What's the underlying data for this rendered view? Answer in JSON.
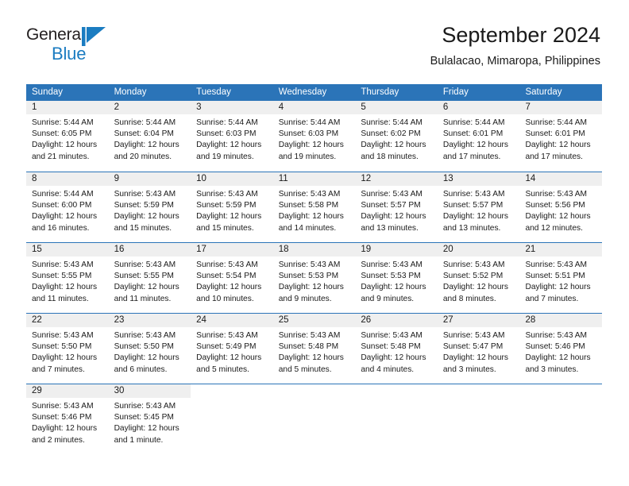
{
  "brand": {
    "name_part1": "General",
    "name_part2": "Blue",
    "mark": "triangle-logo-icon",
    "color_primary": "#1b7cc1",
    "color_text": "#231f20"
  },
  "header": {
    "title": "September 2024",
    "subtitle": "Bulalacao, Mimaropa, Philippines"
  },
  "theme": {
    "header_bar": "#2b74b8",
    "day_band": "#efefef",
    "row_divider": "#2b74b8",
    "text": "#1a1a1a"
  },
  "weekdays": [
    "Sunday",
    "Monday",
    "Tuesday",
    "Wednesday",
    "Thursday",
    "Friday",
    "Saturday"
  ],
  "weeks": [
    [
      {
        "day": "1",
        "sunrise": "Sunrise: 5:44 AM",
        "sunset": "Sunset: 6:05 PM",
        "daylight1": "Daylight: 12 hours",
        "daylight2": "and 21 minutes."
      },
      {
        "day": "2",
        "sunrise": "Sunrise: 5:44 AM",
        "sunset": "Sunset: 6:04 PM",
        "daylight1": "Daylight: 12 hours",
        "daylight2": "and 20 minutes."
      },
      {
        "day": "3",
        "sunrise": "Sunrise: 5:44 AM",
        "sunset": "Sunset: 6:03 PM",
        "daylight1": "Daylight: 12 hours",
        "daylight2": "and 19 minutes."
      },
      {
        "day": "4",
        "sunrise": "Sunrise: 5:44 AM",
        "sunset": "Sunset: 6:03 PM",
        "daylight1": "Daylight: 12 hours",
        "daylight2": "and 19 minutes."
      },
      {
        "day": "5",
        "sunrise": "Sunrise: 5:44 AM",
        "sunset": "Sunset: 6:02 PM",
        "daylight1": "Daylight: 12 hours",
        "daylight2": "and 18 minutes."
      },
      {
        "day": "6",
        "sunrise": "Sunrise: 5:44 AM",
        "sunset": "Sunset: 6:01 PM",
        "daylight1": "Daylight: 12 hours",
        "daylight2": "and 17 minutes."
      },
      {
        "day": "7",
        "sunrise": "Sunrise: 5:44 AM",
        "sunset": "Sunset: 6:01 PM",
        "daylight1": "Daylight: 12 hours",
        "daylight2": "and 17 minutes."
      }
    ],
    [
      {
        "day": "8",
        "sunrise": "Sunrise: 5:44 AM",
        "sunset": "Sunset: 6:00 PM",
        "daylight1": "Daylight: 12 hours",
        "daylight2": "and 16 minutes."
      },
      {
        "day": "9",
        "sunrise": "Sunrise: 5:43 AM",
        "sunset": "Sunset: 5:59 PM",
        "daylight1": "Daylight: 12 hours",
        "daylight2": "and 15 minutes."
      },
      {
        "day": "10",
        "sunrise": "Sunrise: 5:43 AM",
        "sunset": "Sunset: 5:59 PM",
        "daylight1": "Daylight: 12 hours",
        "daylight2": "and 15 minutes."
      },
      {
        "day": "11",
        "sunrise": "Sunrise: 5:43 AM",
        "sunset": "Sunset: 5:58 PM",
        "daylight1": "Daylight: 12 hours",
        "daylight2": "and 14 minutes."
      },
      {
        "day": "12",
        "sunrise": "Sunrise: 5:43 AM",
        "sunset": "Sunset: 5:57 PM",
        "daylight1": "Daylight: 12 hours",
        "daylight2": "and 13 minutes."
      },
      {
        "day": "13",
        "sunrise": "Sunrise: 5:43 AM",
        "sunset": "Sunset: 5:57 PM",
        "daylight1": "Daylight: 12 hours",
        "daylight2": "and 13 minutes."
      },
      {
        "day": "14",
        "sunrise": "Sunrise: 5:43 AM",
        "sunset": "Sunset: 5:56 PM",
        "daylight1": "Daylight: 12 hours",
        "daylight2": "and 12 minutes."
      }
    ],
    [
      {
        "day": "15",
        "sunrise": "Sunrise: 5:43 AM",
        "sunset": "Sunset: 5:55 PM",
        "daylight1": "Daylight: 12 hours",
        "daylight2": "and 11 minutes."
      },
      {
        "day": "16",
        "sunrise": "Sunrise: 5:43 AM",
        "sunset": "Sunset: 5:55 PM",
        "daylight1": "Daylight: 12 hours",
        "daylight2": "and 11 minutes."
      },
      {
        "day": "17",
        "sunrise": "Sunrise: 5:43 AM",
        "sunset": "Sunset: 5:54 PM",
        "daylight1": "Daylight: 12 hours",
        "daylight2": "and 10 minutes."
      },
      {
        "day": "18",
        "sunrise": "Sunrise: 5:43 AM",
        "sunset": "Sunset: 5:53 PM",
        "daylight1": "Daylight: 12 hours",
        "daylight2": "and 9 minutes."
      },
      {
        "day": "19",
        "sunrise": "Sunrise: 5:43 AM",
        "sunset": "Sunset: 5:53 PM",
        "daylight1": "Daylight: 12 hours",
        "daylight2": "and 9 minutes."
      },
      {
        "day": "20",
        "sunrise": "Sunrise: 5:43 AM",
        "sunset": "Sunset: 5:52 PM",
        "daylight1": "Daylight: 12 hours",
        "daylight2": "and 8 minutes."
      },
      {
        "day": "21",
        "sunrise": "Sunrise: 5:43 AM",
        "sunset": "Sunset: 5:51 PM",
        "daylight1": "Daylight: 12 hours",
        "daylight2": "and 7 minutes."
      }
    ],
    [
      {
        "day": "22",
        "sunrise": "Sunrise: 5:43 AM",
        "sunset": "Sunset: 5:50 PM",
        "daylight1": "Daylight: 12 hours",
        "daylight2": "and 7 minutes."
      },
      {
        "day": "23",
        "sunrise": "Sunrise: 5:43 AM",
        "sunset": "Sunset: 5:50 PM",
        "daylight1": "Daylight: 12 hours",
        "daylight2": "and 6 minutes."
      },
      {
        "day": "24",
        "sunrise": "Sunrise: 5:43 AM",
        "sunset": "Sunset: 5:49 PM",
        "daylight1": "Daylight: 12 hours",
        "daylight2": "and 5 minutes."
      },
      {
        "day": "25",
        "sunrise": "Sunrise: 5:43 AM",
        "sunset": "Sunset: 5:48 PM",
        "daylight1": "Daylight: 12 hours",
        "daylight2": "and 5 minutes."
      },
      {
        "day": "26",
        "sunrise": "Sunrise: 5:43 AM",
        "sunset": "Sunset: 5:48 PM",
        "daylight1": "Daylight: 12 hours",
        "daylight2": "and 4 minutes."
      },
      {
        "day": "27",
        "sunrise": "Sunrise: 5:43 AM",
        "sunset": "Sunset: 5:47 PM",
        "daylight1": "Daylight: 12 hours",
        "daylight2": "and 3 minutes."
      },
      {
        "day": "28",
        "sunrise": "Sunrise: 5:43 AM",
        "sunset": "Sunset: 5:46 PM",
        "daylight1": "Daylight: 12 hours",
        "daylight2": "and 3 minutes."
      }
    ],
    [
      {
        "day": "29",
        "sunrise": "Sunrise: 5:43 AM",
        "sunset": "Sunset: 5:46 PM",
        "daylight1": "Daylight: 12 hours",
        "daylight2": "and 2 minutes."
      },
      {
        "day": "30",
        "sunrise": "Sunrise: 5:43 AM",
        "sunset": "Sunset: 5:45 PM",
        "daylight1": "Daylight: 12 hours",
        "daylight2": "and 1 minute."
      },
      {
        "day": "",
        "sunrise": "",
        "sunset": "",
        "daylight1": "",
        "daylight2": ""
      },
      {
        "day": "",
        "sunrise": "",
        "sunset": "",
        "daylight1": "",
        "daylight2": ""
      },
      {
        "day": "",
        "sunrise": "",
        "sunset": "",
        "daylight1": "",
        "daylight2": ""
      },
      {
        "day": "",
        "sunrise": "",
        "sunset": "",
        "daylight1": "",
        "daylight2": ""
      },
      {
        "day": "",
        "sunrise": "",
        "sunset": "",
        "daylight1": "",
        "daylight2": ""
      }
    ]
  ]
}
